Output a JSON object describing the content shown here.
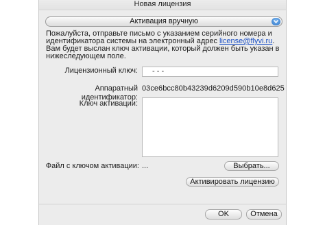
{
  "window": {
    "title": "Новая лицензия"
  },
  "mode_select": {
    "selected": "Активация вручную"
  },
  "description": {
    "text_before_link": "Пожалуйста, отправьте письмо с указанием серийного номера и идентификатора системы на электронный адрес ",
    "email": "license@flyvi.ru",
    "text_after_link": ". Вам будет выслан ключ активации, который должен быть указан в нижеследующем поле."
  },
  "license_key": {
    "label": "Лицензионный ключ:",
    "value": "-   -   -"
  },
  "hardware_id": {
    "label": "Аппаратный идентификатор:",
    "value": "03ce6bcc80b43239d6209d590b10e8d625"
  },
  "activation_key": {
    "label": "Ключ активации:",
    "value": ""
  },
  "key_file": {
    "label": "Файл с ключом активации:",
    "value": "...",
    "browse_label": "Выбрать..."
  },
  "activate_button": {
    "label": "Активировать лицензию"
  },
  "footer": {
    "ok_label": "OK",
    "cancel_label": "Отмена"
  }
}
